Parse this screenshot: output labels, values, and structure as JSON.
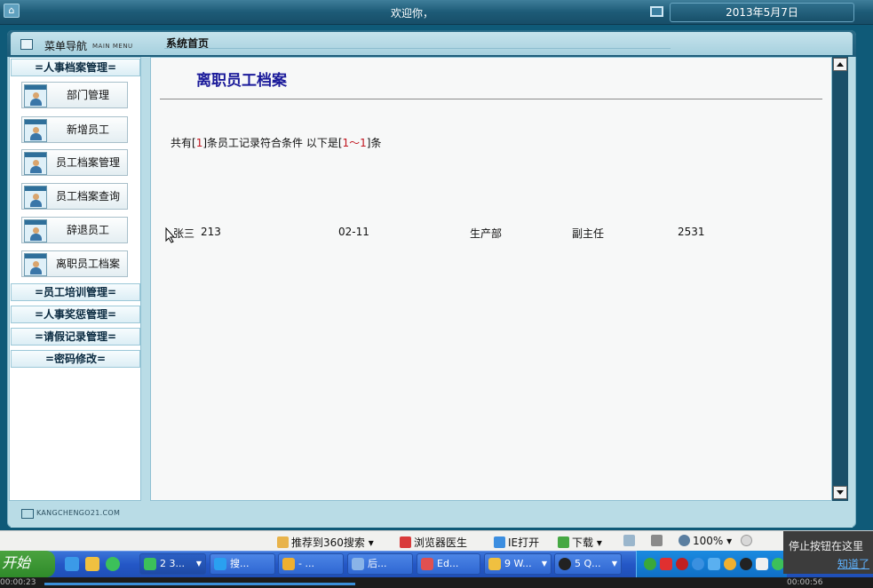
{
  "header": {
    "welcome": "欢迎你，",
    "date": "2013年5月7日"
  },
  "nav": {
    "title": "菜单导航",
    "title_en": "MAIN MENU",
    "categories": [
      "=人事档案管理=",
      "=员工培训管理=",
      "=人事奖惩管理=",
      "=请假记录管理=",
      "=密码修改="
    ],
    "items": [
      "部门管理",
      "新增员工",
      "员工档案管理",
      "员工档案查询",
      "辞退员工",
      "离职员工档案"
    ],
    "footer_logo": "KANGCHENGO21.COM"
  },
  "breadcrumb": {
    "title": "系统首页"
  },
  "content": {
    "title": "离职员工档案",
    "summary": {
      "prefix": "共有[",
      "count": "1",
      "middle": "]条员工记录符合条件 以下是[",
      "range": "1～1",
      "suffix": "]条"
    },
    "record": {
      "name": "张三",
      "id": "213",
      "date": "02-11",
      "department": "生产部",
      "position": "副主任",
      "number": "2531"
    }
  },
  "browser_status": {
    "recommend": "推荐到360搜索",
    "doctor": "浏览器医生",
    "ie_open": "IE打开",
    "download": "下载",
    "zoom": "100%"
  },
  "taskbar": {
    "start": "开始",
    "tasks": [
      "2 3...",
      "搜...",
      "- ...",
      "后...",
      "Ed...",
      "9 W...",
      "5 Q..."
    ]
  },
  "tooltip": {
    "text": "停止按钮在这里",
    "link": "知道了"
  },
  "recorder": {
    "elapsed": "00:00:23",
    "total": "00:00:56"
  },
  "colors": {
    "accent_blue": "#1a1a9a",
    "highlight_red": "#c0141e",
    "frame": "#b9dce6"
  }
}
